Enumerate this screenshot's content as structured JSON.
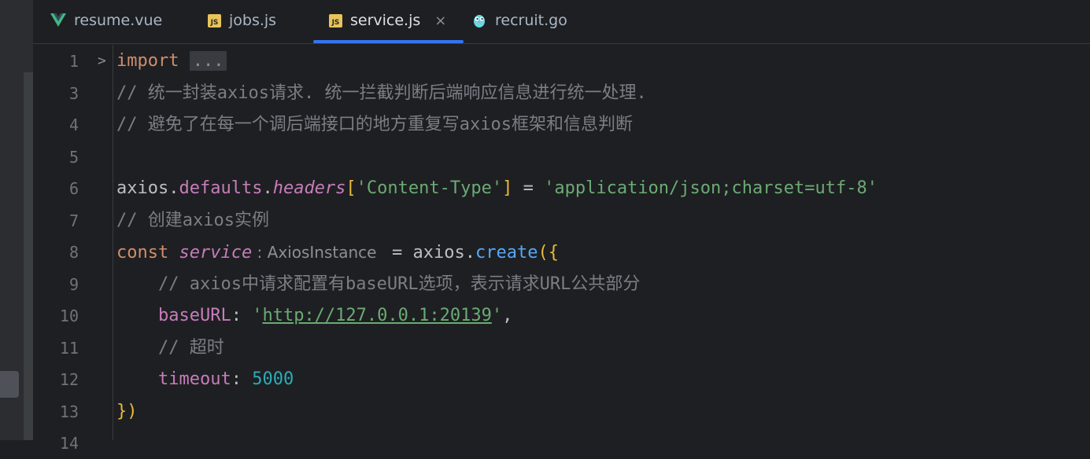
{
  "tabs": [
    {
      "label": "resume.vue",
      "icon": "vue-icon",
      "active": false
    },
    {
      "label": "jobs.js",
      "icon": "js-file-icon",
      "active": false
    },
    {
      "label": "service.js",
      "icon": "js-file-icon",
      "active": true
    },
    {
      "label": "recruit.go",
      "icon": "go-gopher-icon",
      "active": false
    }
  ],
  "close_glyph": "×",
  "fold_glyph": ">",
  "lines": [
    {
      "num": "1",
      "t": [
        "import",
        "..."
      ]
    },
    {
      "num": "3",
      "t": [
        "// 统一封装axios请求. 统一拦截判断后端响应信息进行统一处理."
      ]
    },
    {
      "num": "4",
      "t": [
        "// 避免了在每一个调后端接口的地方重复写axios框架和信息判断"
      ]
    },
    {
      "num": "5",
      "t": []
    },
    {
      "num": "6",
      "t": [
        "axios",
        ".",
        "defaults",
        ".",
        "headers",
        "[",
        "'Content-Type'",
        "]",
        " = ",
        "'application/json;charset=utf-8'"
      ]
    },
    {
      "num": "7",
      "t": [
        "// 创建axios实例"
      ]
    },
    {
      "num": "8",
      "t": [
        "const ",
        "service",
        " : AxiosInstance ",
        " = axios.",
        "create",
        "(",
        "{"
      ]
    },
    {
      "num": "9",
      "t": [
        "// axios中请求配置有baseURL选项，表示请求URL公共部分"
      ]
    },
    {
      "num": "10",
      "t": [
        "baseURL",
        ": ",
        "'",
        "http://127.0.0.1:20139",
        "'",
        ","
      ]
    },
    {
      "num": "11",
      "t": [
        "// 超时"
      ]
    },
    {
      "num": "12",
      "t": [
        "timeout",
        ": ",
        "5000"
      ]
    },
    {
      "num": "13",
      "t": [
        "}",
        ")"
      ]
    },
    {
      "num": "14",
      "t": []
    }
  ],
  "colors": {
    "background": "#1e1f22",
    "keyword": "#cf8e6d",
    "comment": "#7a7e85",
    "string": "#6aab73",
    "number": "#2aacb8",
    "function": "#56a8f5",
    "property": "#c77dbb",
    "bracket": "#e8ba36",
    "active_tab_underline": "#3574f0"
  }
}
